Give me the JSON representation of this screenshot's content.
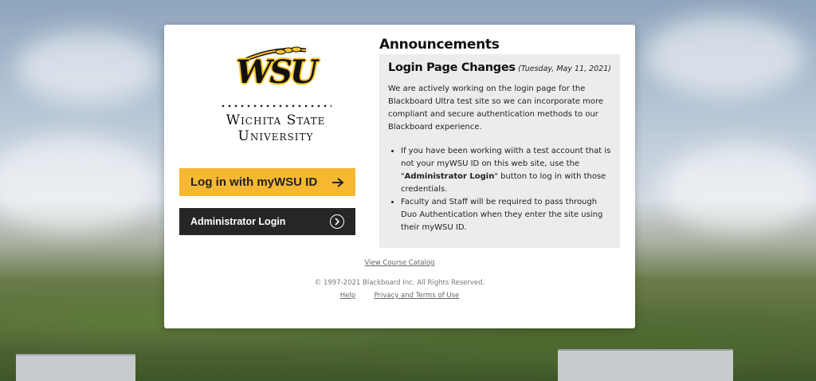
{
  "brand": {
    "logo_text": "WSU",
    "university_line1": "Wichita State",
    "university_line2": "University"
  },
  "buttons": {
    "primary_label": "Log in with myWSU ID",
    "primary_icon": "arrow-right-icon",
    "secondary_label": "Administrator Login",
    "secondary_icon": "circle-chevron-right-icon"
  },
  "announcements": {
    "heading": "Announcements",
    "item_title": "Login Page Changes",
    "item_date": "(Tuesday, May 11, 2021)",
    "paragraph": "We are actively working on the login page for the Blackboard Ultra test site so we can incorporate more compliant and secure authentication methods to our Blackboard experience.",
    "bullet1_pre": "If you have been working wiith a test account that is not your myWSU ID on this web site, use the \"",
    "bullet1_bold": "Administrator Login",
    "bullet1_post": "\" button to log in with those credentials.",
    "bullet2": "Faculty and Staff will be required to pass through Duo Authentication when they enter the site using their myWSU ID."
  },
  "footer": {
    "catalog_link": "View Course Catalog",
    "copyright": "© 1997-2021 Blackboard Inc. All Rights Reserved.",
    "help_link": "Help",
    "privacy_link": "Privacy and Terms of Use"
  },
  "colors": {
    "accent_gold": "#f6b831",
    "dark_button": "#262626",
    "panel_gray": "#ececec"
  }
}
